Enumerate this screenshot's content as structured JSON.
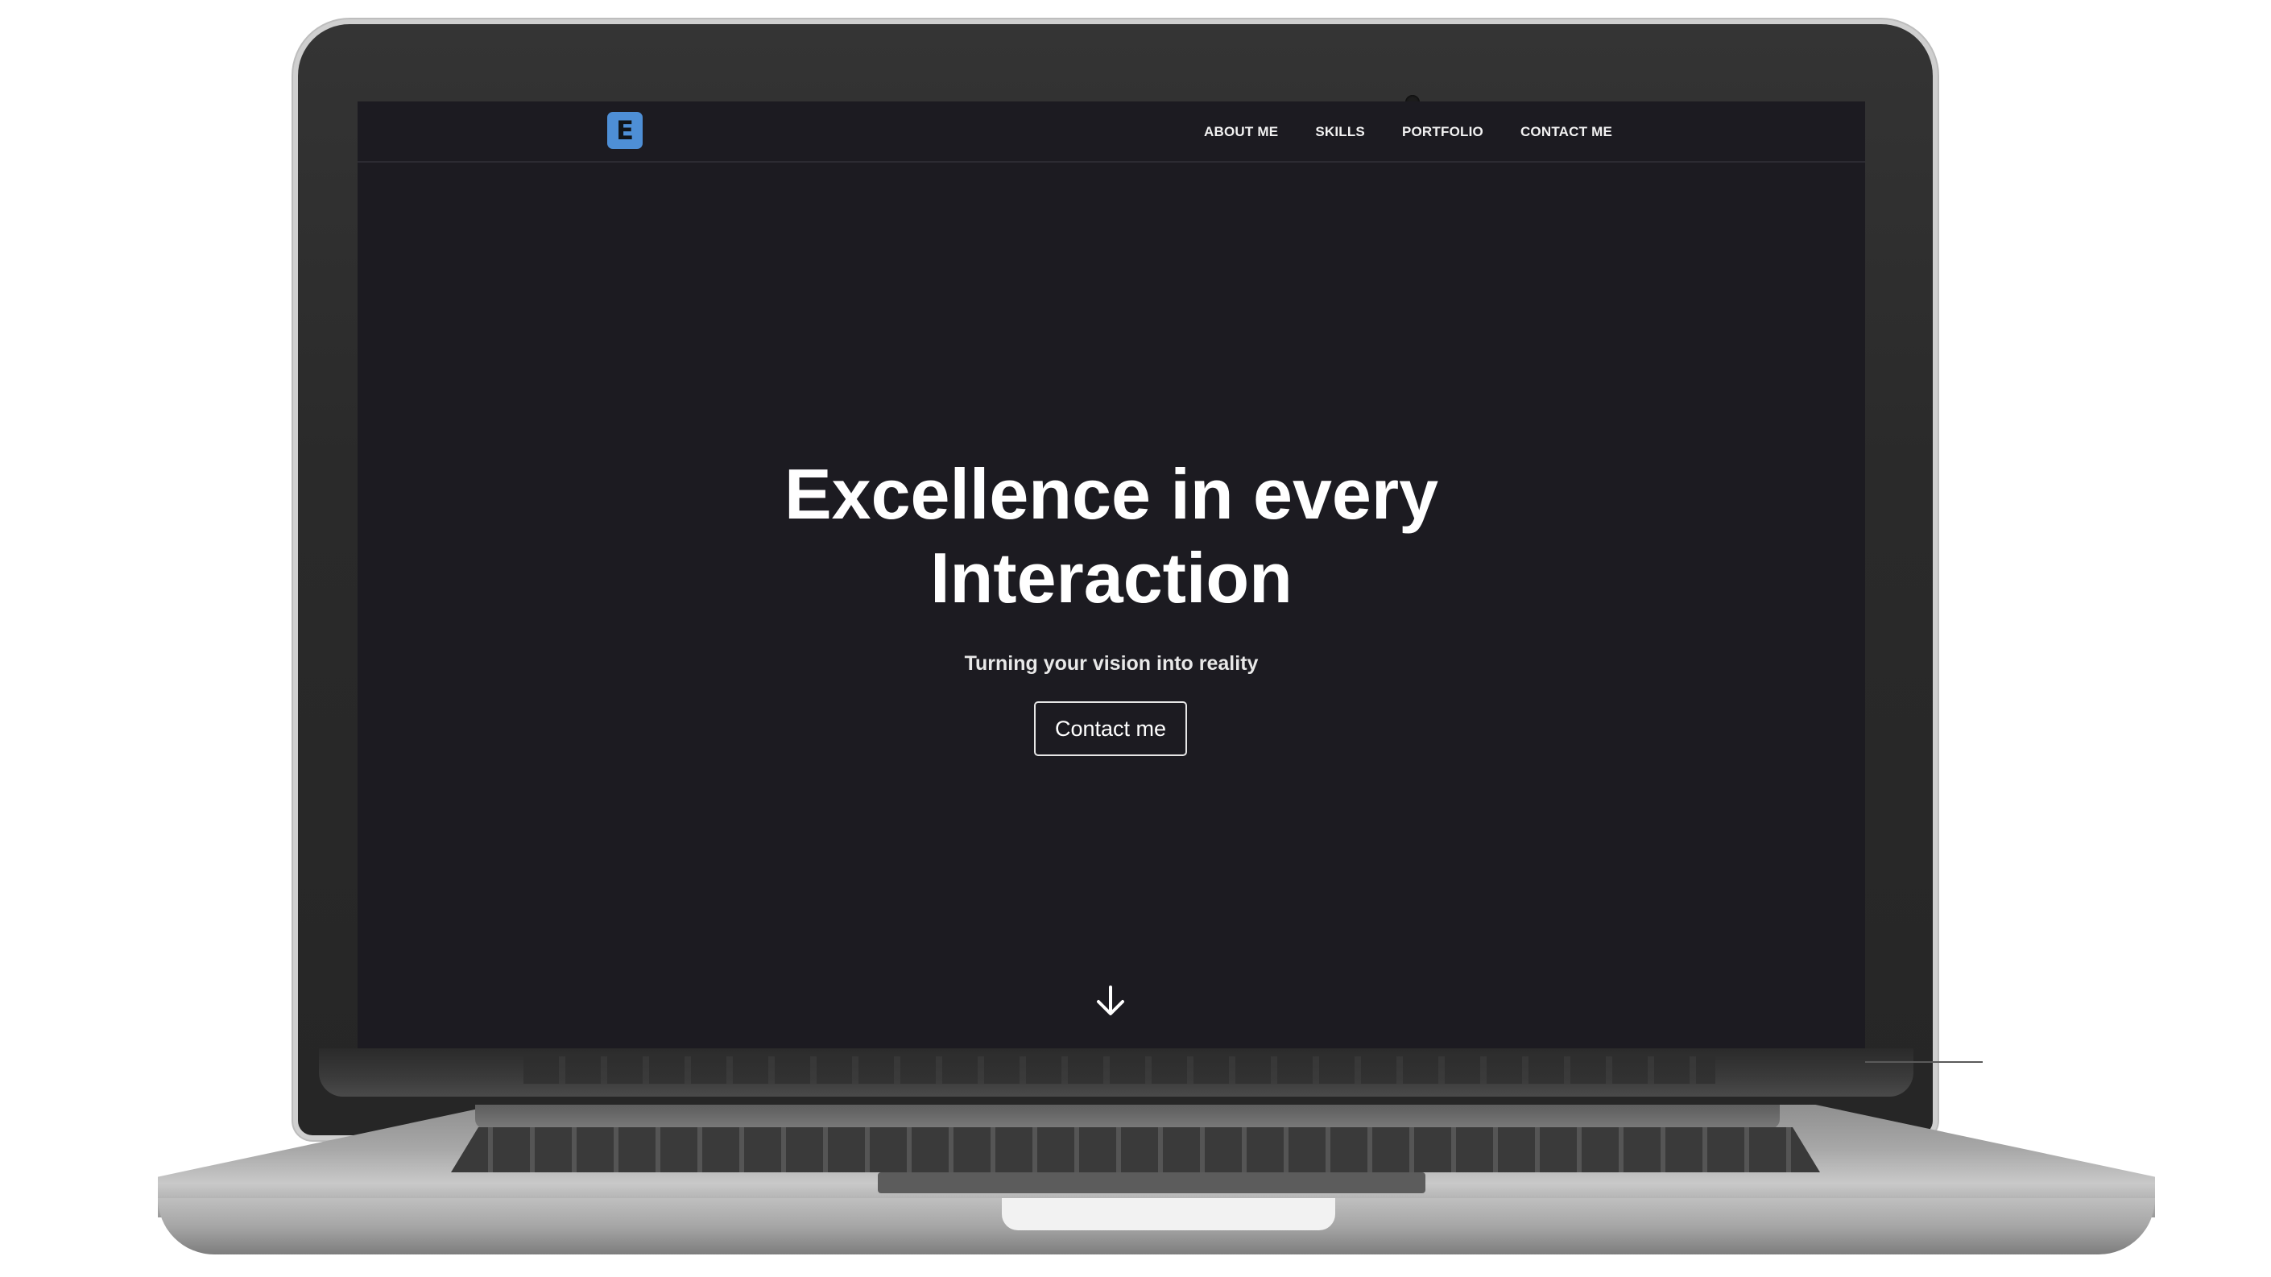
{
  "nav": {
    "logo": "E",
    "links": [
      "ABOUT ME",
      "SKILLS",
      "PORTFOLIO",
      "CONTACT ME"
    ]
  },
  "hero": {
    "title_line1": "Excellence in every",
    "title_line2": "Interaction",
    "subtitle": "Turning your vision into reality",
    "cta": "Contact me"
  },
  "colors": {
    "background": "#1c1b21",
    "logo": "#4e8fd6",
    "text": "#ffffff"
  },
  "icons": {
    "scroll": "arrow-down-icon"
  }
}
